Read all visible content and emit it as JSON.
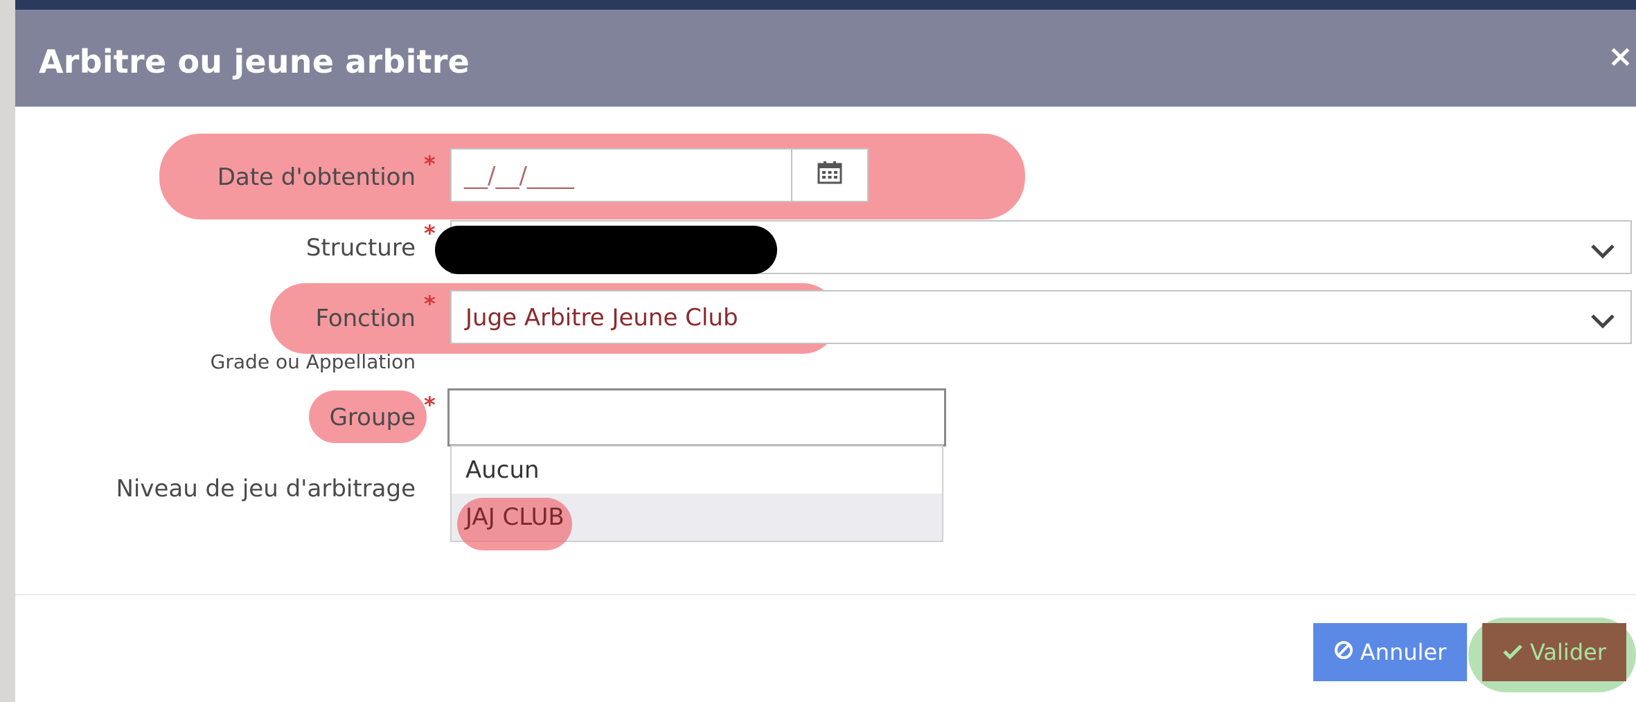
{
  "dialog": {
    "title": "Arbitre ou jeune arbitre",
    "close_label": "×"
  },
  "form": {
    "date": {
      "label": "Date d'obtention",
      "required": "*",
      "value": "__/__/____"
    },
    "structure": {
      "label": "Structure",
      "required": "*",
      "value": ""
    },
    "fonction": {
      "label": "Fonction",
      "required": "*",
      "value": "Juge Arbitre Jeune Club"
    },
    "grade": {
      "label": "Grade ou Appellation"
    },
    "groupe": {
      "label": "Groupe",
      "required": "*",
      "value": ""
    },
    "niveau": {
      "label": "Niveau de jeu d'arbitrage"
    }
  },
  "groupe_dropdown": {
    "options": [
      "Aucun",
      "JAJ CLUB"
    ],
    "highlighted_index": 1
  },
  "footer": {
    "cancel_label": "Annuler",
    "submit_label": "Valider"
  },
  "colors": {
    "header_bg": "#808399",
    "cancel_bg": "#5b8ae6",
    "submit_bg": "#8c5a42",
    "annotation_red": "#f0646e",
    "annotation_green": "#78c878"
  },
  "icons": {
    "calendar": "calendar-icon",
    "chevron": "chevron-down-icon",
    "cancel": "ban-icon",
    "submit": "check-icon"
  }
}
